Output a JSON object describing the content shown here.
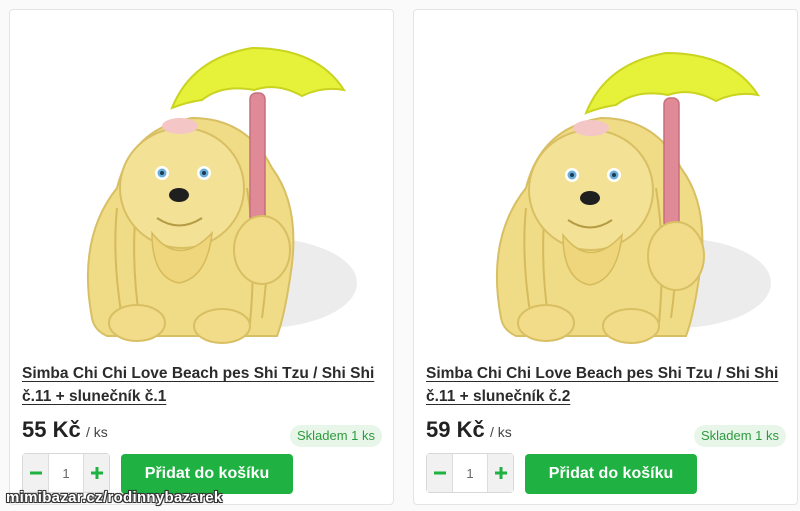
{
  "products": [
    {
      "title": "Simba Chi Chi Love Beach pes Shi Tzu / Shi Shi č.11 + slunečník č.1",
      "price": "55 Kč",
      "unit": "/ ks",
      "stock": "Skladem 1 ks",
      "quantity": "1",
      "add_label": "Přidat do košíku",
      "image_icon": "dog-with-umbrella-figurine-image"
    },
    {
      "title": "Simba Chi Chi Love Beach pes Shi Tzu / Shi Shi č.11 + slunečník č.2",
      "price": "59 Kč",
      "unit": "/ ks",
      "stock": "Skladem 1 ks",
      "quantity": "1",
      "add_label": "Přidat do košíku",
      "image_icon": "dog-with-umbrella-figurine-image"
    }
  ],
  "watermark": "mimibazar.cz/rodinnybazarek",
  "colors": {
    "accent_green": "#1fb141",
    "stock_green": "#2e9a3e",
    "stock_bg": "#e8f6ea",
    "umbrella_yellow": "#e6f23a",
    "dog_fur": "#f0db86",
    "umbrella_pole": "#e08a98"
  }
}
